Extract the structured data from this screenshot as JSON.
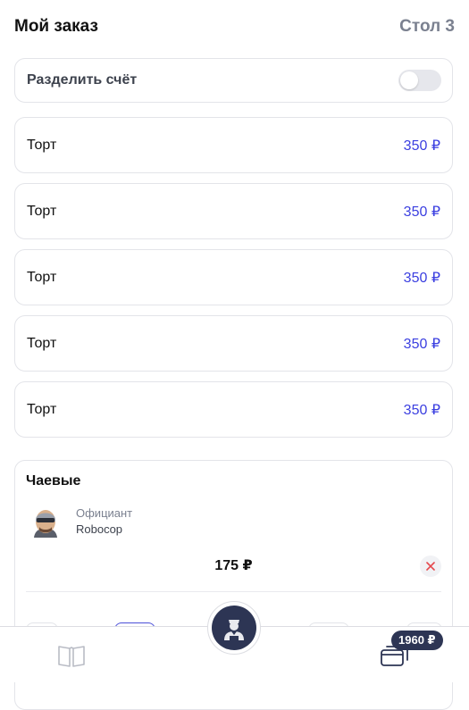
{
  "header": {
    "title": "Мой заказ",
    "table": "Стол 3"
  },
  "split": {
    "label": "Разделить счёт",
    "enabled": false
  },
  "items": [
    {
      "name": "Торт",
      "price": "350 ₽"
    },
    {
      "name": "Торт",
      "price": "350 ₽"
    },
    {
      "name": "Торт",
      "price": "350 ₽"
    },
    {
      "name": "Торт",
      "price": "350 ₽"
    },
    {
      "name": "Торт",
      "price": "350 ₽"
    }
  ],
  "tips": {
    "title": "Чаевые",
    "waiter_role": "Официант",
    "waiter_name": "Robocop",
    "amount": "175 ₽"
  },
  "bottom_nav": {
    "cart_total": "1960 ₽",
    "menu_icon": "book-icon",
    "center_icon": "waiter-icon",
    "cart_icon": "card-icon"
  },
  "colors": {
    "accent": "#3b3fe0",
    "dark": "#2d3554",
    "muted": "#7b8190",
    "danger": "#e5484d"
  }
}
